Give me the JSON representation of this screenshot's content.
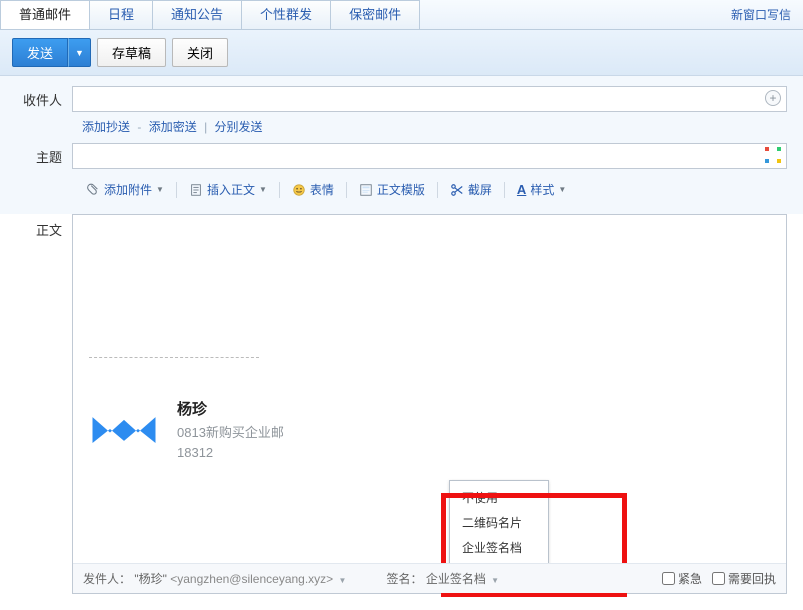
{
  "tabs": {
    "t0": "普通邮件",
    "t1": "日程",
    "t2": "通知公告",
    "t3": "个性群发",
    "t4": "保密邮件",
    "new_window": "新窗口写信"
  },
  "toolbar": {
    "send": "发送",
    "draft": "存草稿",
    "close": "关闭"
  },
  "fields": {
    "recipient_label": "收件人",
    "recipient_value": "",
    "add_cc": "添加抄送",
    "add_bcc": "添加密送",
    "send_separate": "分别发送",
    "subject_label": "主题",
    "subject_value": "",
    "body_label": "正文"
  },
  "fmt": {
    "attach": "添加附件",
    "insert_body": "插入正文",
    "emoji": "表情",
    "template": "正文模版",
    "screenshot": "截屏",
    "style": "样式"
  },
  "signature": {
    "name": "杨珍",
    "line1": "0813新购买企业邮",
    "line2": "18312"
  },
  "footer": {
    "sender_prefix": "发件人：",
    "sender_name": "\"杨珍\"",
    "sender_email": "<yangzhen@silenceyang.xyz>",
    "sig_label": "签名：",
    "sig_value": "企业签名档",
    "urgent": "紧急",
    "receipt": "需要回执"
  },
  "sig_menu": {
    "opt0": "不使用",
    "opt1": "二维码名片",
    "opt2": "企业签名档"
  }
}
